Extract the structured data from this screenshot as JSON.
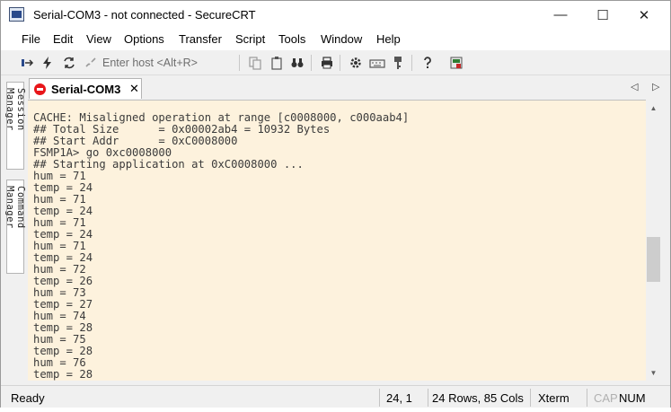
{
  "window": {
    "title": "Serial-COM3 - not connected - SecureCRT",
    "minimize": "—",
    "maximize": "☐",
    "close": "✕"
  },
  "menu": [
    "File",
    "Edit",
    "View",
    "Options",
    "Transfer",
    "Script",
    "Tools",
    "Window",
    "Help"
  ],
  "toolbar": {
    "host_placeholder": "Enter host <Alt+R>"
  },
  "side_tabs": [
    "Session Manager",
    "Command Manager"
  ],
  "tab": {
    "label": "Serial-COM3",
    "close": "✕"
  },
  "tab_nav": {
    "prev": "◁",
    "next": "▷"
  },
  "terminal": {
    "lines": [
      "CACHE: Misaligned operation at range [c0008000, c000aab4]",
      "## Total Size      = 0x00002ab4 = 10932 Bytes",
      "## Start Addr      = 0xC0008000",
      "FSMP1A> go 0xc0008000",
      "## Starting application at 0xC0008000 ...",
      "hum = 71",
      "temp = 24",
      "hum = 71",
      "temp = 24",
      "hum = 71",
      "temp = 24",
      "hum = 71",
      "temp = 24",
      "hum = 72",
      "temp = 26",
      "hum = 73",
      "temp = 27",
      "hum = 74",
      "temp = 28",
      "hum = 75",
      "temp = 28",
      "hum = 76",
      "temp = 28"
    ]
  },
  "status": {
    "ready": "Ready",
    "cursor": "24,  1",
    "size": "24 Rows, 85 Cols",
    "emulation": "Xterm",
    "cap": "CAP",
    "num": "NUM"
  },
  "colors": {
    "terminal_bg": "#fdf2dd",
    "terminal_fg": "#3b3b3b",
    "tab_status": "#e8161a"
  }
}
